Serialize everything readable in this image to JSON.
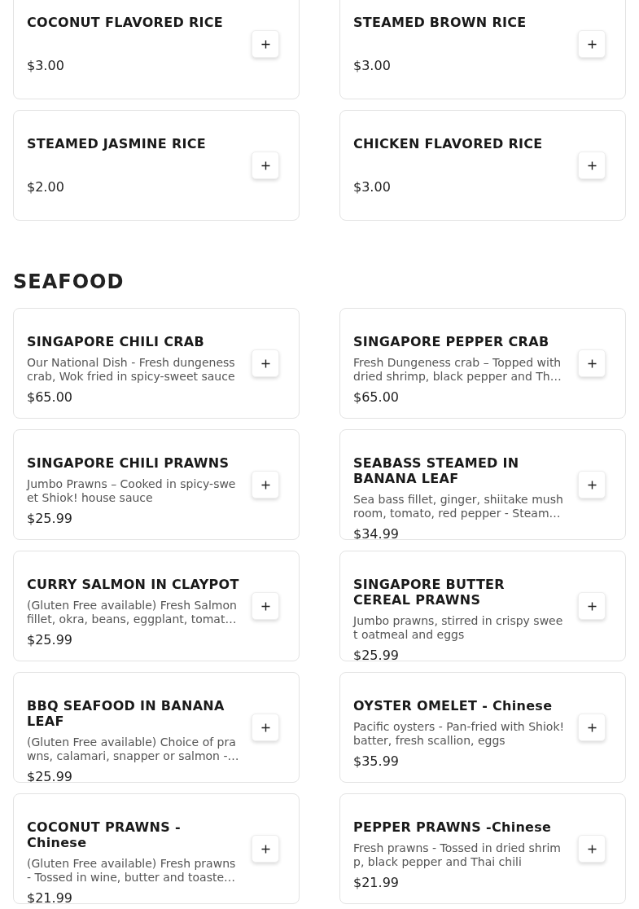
{
  "sections": [
    {
      "items": [
        {
          "name": "COCONUT FLAVORED RICE",
          "price": "$3.00"
        },
        {
          "name": "STEAMED BROWN RICE",
          "price": "$3.00"
        },
        {
          "name": "STEAMED JASMINE RICE",
          "price": "$2.00"
        },
        {
          "name": "CHICKEN FLAVORED RICE",
          "price": "$3.00"
        }
      ]
    },
    {
      "title": "SEAFOOD",
      "items": [
        {
          "name": "SINGAPORE CHILI CRAB",
          "description": "Our National Dish - Fresh dungeness crab, Wok fried in spicy-sweet sauce",
          "price": "$65.00"
        },
        {
          "name": "SINGAPORE PEPPER CRAB",
          "description": "Fresh Dungeness crab – Topped with dried shrimp, black pepper and Th…",
          "price": "$65.00"
        },
        {
          "name": "SINGAPORE CHILI PRAWNS",
          "description": "Jumbo Prawns – Cooked in spicy-sweet Shiok! house sauce",
          "price": "$25.99"
        },
        {
          "name": "SEABASS STEAMED IN BANANA LEAF",
          "description": "Sea bass fillet, ginger, shiitake mushroom, tomato, red pepper - Steam…",
          "price": "$34.99"
        },
        {
          "name": "CURRY SALMON IN CLAYPOT",
          "description": "(Gluten Free available) Fresh Salmon fillet, okra, beans, eggplant, tomat…",
          "price": "$25.99"
        },
        {
          "name": "SINGAPORE BUTTER CEREAL PRAWNS",
          "description": "Jumbo prawns, stirred in crispy sweet oatmeal and eggs",
          "price": "$25.99"
        },
        {
          "name": "BBQ SEAFOOD IN BANANA LEAF",
          "description": "(Gluten Free available) Choice of prawns, calamari, snapper or salmon -…",
          "price": "$25.99"
        },
        {
          "name": "OYSTER OMELET - Chinese",
          "description": "Pacific oysters - Pan-fried with Shiok! batter, fresh scallion, eggs",
          "price": "$35.99"
        },
        {
          "name": "COCONUT PRAWNS - Chinese",
          "description": "(Gluten Free available) Fresh prawns - Tossed in wine, butter and toaste…",
          "price": "$21.99"
        },
        {
          "name": "PEPPER PRAWNS -Chinese",
          "description": "Fresh prawns - Tossed in dried shrimp, black pepper and Thai chili",
          "price": "$21.99"
        }
      ]
    }
  ]
}
